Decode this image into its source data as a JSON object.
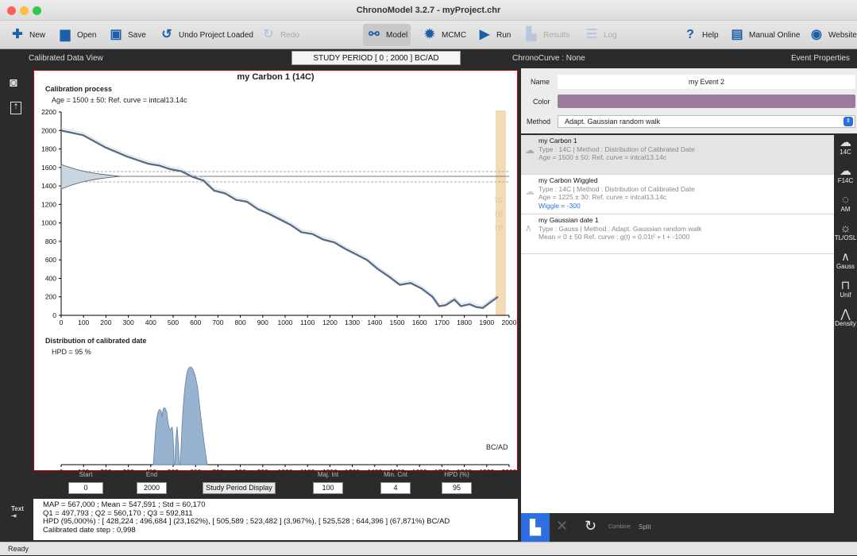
{
  "window": {
    "title": "ChronoModel 3.2.7 - myProject.chr"
  },
  "toolbar": {
    "new": "New",
    "open": "Open",
    "save": "Save",
    "undo": "Undo Project Loaded",
    "redo": "Redo",
    "model": "Model",
    "mcmc": "MCMC",
    "run": "Run",
    "results": "Results",
    "log": "Log",
    "help": "Help",
    "manual": "Manual Online",
    "website": "Website"
  },
  "header": {
    "left": "Calibrated Data View",
    "study_period": "STUDY PERIOD [ 0 ; 2000 ] BC/AD",
    "chronocurve": "ChronoCurve : None",
    "right": "Event Properties"
  },
  "calibration": {
    "title": "my Carbon 1 (14C)",
    "process_label": "Calibration process",
    "age_label": "Age = 1500  ± 50: Ref. curve = intcal13.14c",
    "dist_label": "Distribution of calibrated date",
    "hpd_label": "HPD = 95 %",
    "unit": "BC/AD",
    "y_ticks": [
      "2200",
      "2000",
      "1800",
      "1600",
      "1400",
      "1200",
      "1000",
      "800",
      "600",
      "400",
      "200",
      "0"
    ],
    "x_ticks": [
      "0",
      "100",
      "200",
      "300",
      "400",
      "500",
      "600",
      "700",
      "800",
      "900",
      "1000",
      "1100",
      "1200",
      "1300",
      "1400",
      "1500",
      "1600",
      "1700",
      "1800",
      "1900",
      "2000"
    ],
    "bg_text": [
      "ts",
      "re",
      "re"
    ]
  },
  "params": {
    "start_label": "Start",
    "start_value": "0",
    "end_label": "End",
    "end_value": "2000",
    "study_button": "Study Period Display",
    "majint_label": "Maj. Int",
    "majint_value": "100",
    "mincnt_label": "Min. Cnt",
    "mincnt_value": "4",
    "hpd_label": "HPD (%)",
    "hpd_value": "95"
  },
  "results": {
    "icon_label": "Text",
    "line1": "MAP = 567,000 ; Mean = 547,591 ; Std = 60,170",
    "line2": "Q1 = 497,793 ; Q2 = 560,170 ; Q3 = 592,811",
    "line3": "HPD (95,000%) : [ 428,224 ; 496,684 ] (23,162%), [ 505,589 ; 523,482 ] (3,967%), [ 525,528 ; 644,396 ] (67,871%) BC/AD",
    "line4": "Calibrated date step : 0,998"
  },
  "event": {
    "name_label": "Name",
    "name_value": "my Event 2",
    "color_label": "Color",
    "color_value": "#9b7a9b",
    "method_label": "Method",
    "method_value": "Adapt. Gaussian random walk"
  },
  "dates": [
    {
      "name": "my Carbon 1",
      "type": "Type : 14C | Method : Distribution of Calibrated Date",
      "age": "Age = 1500  ± 50: Ref. curve = intcal13.14c",
      "extra": ""
    },
    {
      "name": "my Carbon Wiggled",
      "type": "Type : 14C | Method : Distribution of Calibrated Date",
      "age": "Age = 1225  ± 30: Ref. curve = intcal13.14c",
      "extra": "Wiggle = -300"
    },
    {
      "name": "my Gaussian date 1",
      "type": "Type : Gauss | Method : Adapt. Gaussian random walk",
      "age": "Mean = 0  ±  50 Ref. curve : g(t) = 0,01t² + t + -1000",
      "extra": ""
    }
  ],
  "right_tools": [
    "14C",
    "F14C",
    "AM",
    "TL/OSL",
    "Gauss",
    "Unif",
    "Density"
  ],
  "bottom_tools": {
    "combine": "Combine",
    "split": "Split"
  },
  "status": {
    "text": "Ready"
  }
}
